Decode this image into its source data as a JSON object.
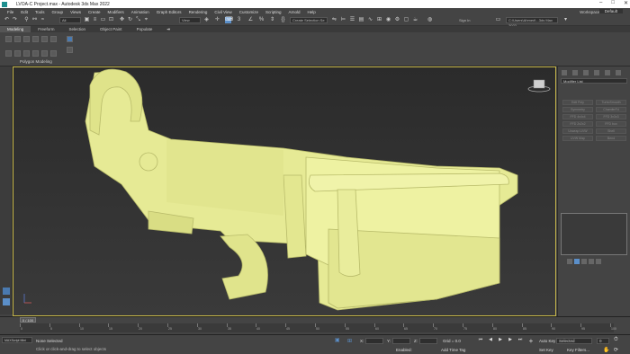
{
  "window": {
    "title": "LVOA-C Project.max - Autodesk 3ds Max 2022"
  },
  "menu": {
    "items": [
      "File",
      "Edit",
      "Tools",
      "Group",
      "Views",
      "Create",
      "Modifiers",
      "Animation",
      "Graph Editors",
      "Rendering",
      "Civil View",
      "Customize",
      "Scripting",
      "Arnold",
      "Help"
    ],
    "workspaces_label": "Workspaces:",
    "workspaces_value": "Default"
  },
  "toolbar": {
    "selection_filter": "All",
    "view_coord": "View",
    "create_selection_set": "Create Selection Se",
    "signin_label": "Sign In",
    "project_path": "C:\\Users\\Ahmed\\...3ds Max 2022"
  },
  "ribbon": {
    "tabs": [
      "Modeling",
      "Freeform",
      "Selection",
      "Object Paint",
      "Populate"
    ],
    "panel_label": "Polygon Modeling"
  },
  "viewport": {
    "label": "[+] [Orthographic] [Standard] [Default Shading]",
    "model_color": "#eaee9a"
  },
  "command_panel": {
    "modifier_list": "Modifier List",
    "buttons": [
      "Edit Poly",
      "TurboSmooth",
      "Symmetry",
      "ChamferFd",
      "FFD 4x4x4",
      "FFD 3x3x3",
      "FFD 2x2x2",
      "FFD box",
      "Unwrap UVW",
      "Shell",
      "UVW Map",
      "Bend"
    ]
  },
  "timeline": {
    "frame": "0 / 100",
    "ticks": [
      "0",
      "5",
      "10",
      "15",
      "20",
      "25",
      "30",
      "35",
      "40",
      "45",
      "50",
      "55",
      "60",
      "65",
      "70",
      "75",
      "80",
      "85",
      "90",
      "95",
      "100"
    ]
  },
  "status": {
    "maxscript": "MAXScript Mini",
    "selection": "None Selected",
    "prompt": "Click or click-and-drag to select objects",
    "x_label": "X:",
    "y_label": "Y:",
    "z_label": "Z:",
    "grid": "Grid = 0.0",
    "enabled_label": "Enabled:",
    "add_time_tag": "Add Time Tag",
    "auto_key": "Auto Key",
    "selected": "Selected",
    "set_key": "Set Key",
    "key_filters": "Key Filters...",
    "frame_value": "0"
  }
}
